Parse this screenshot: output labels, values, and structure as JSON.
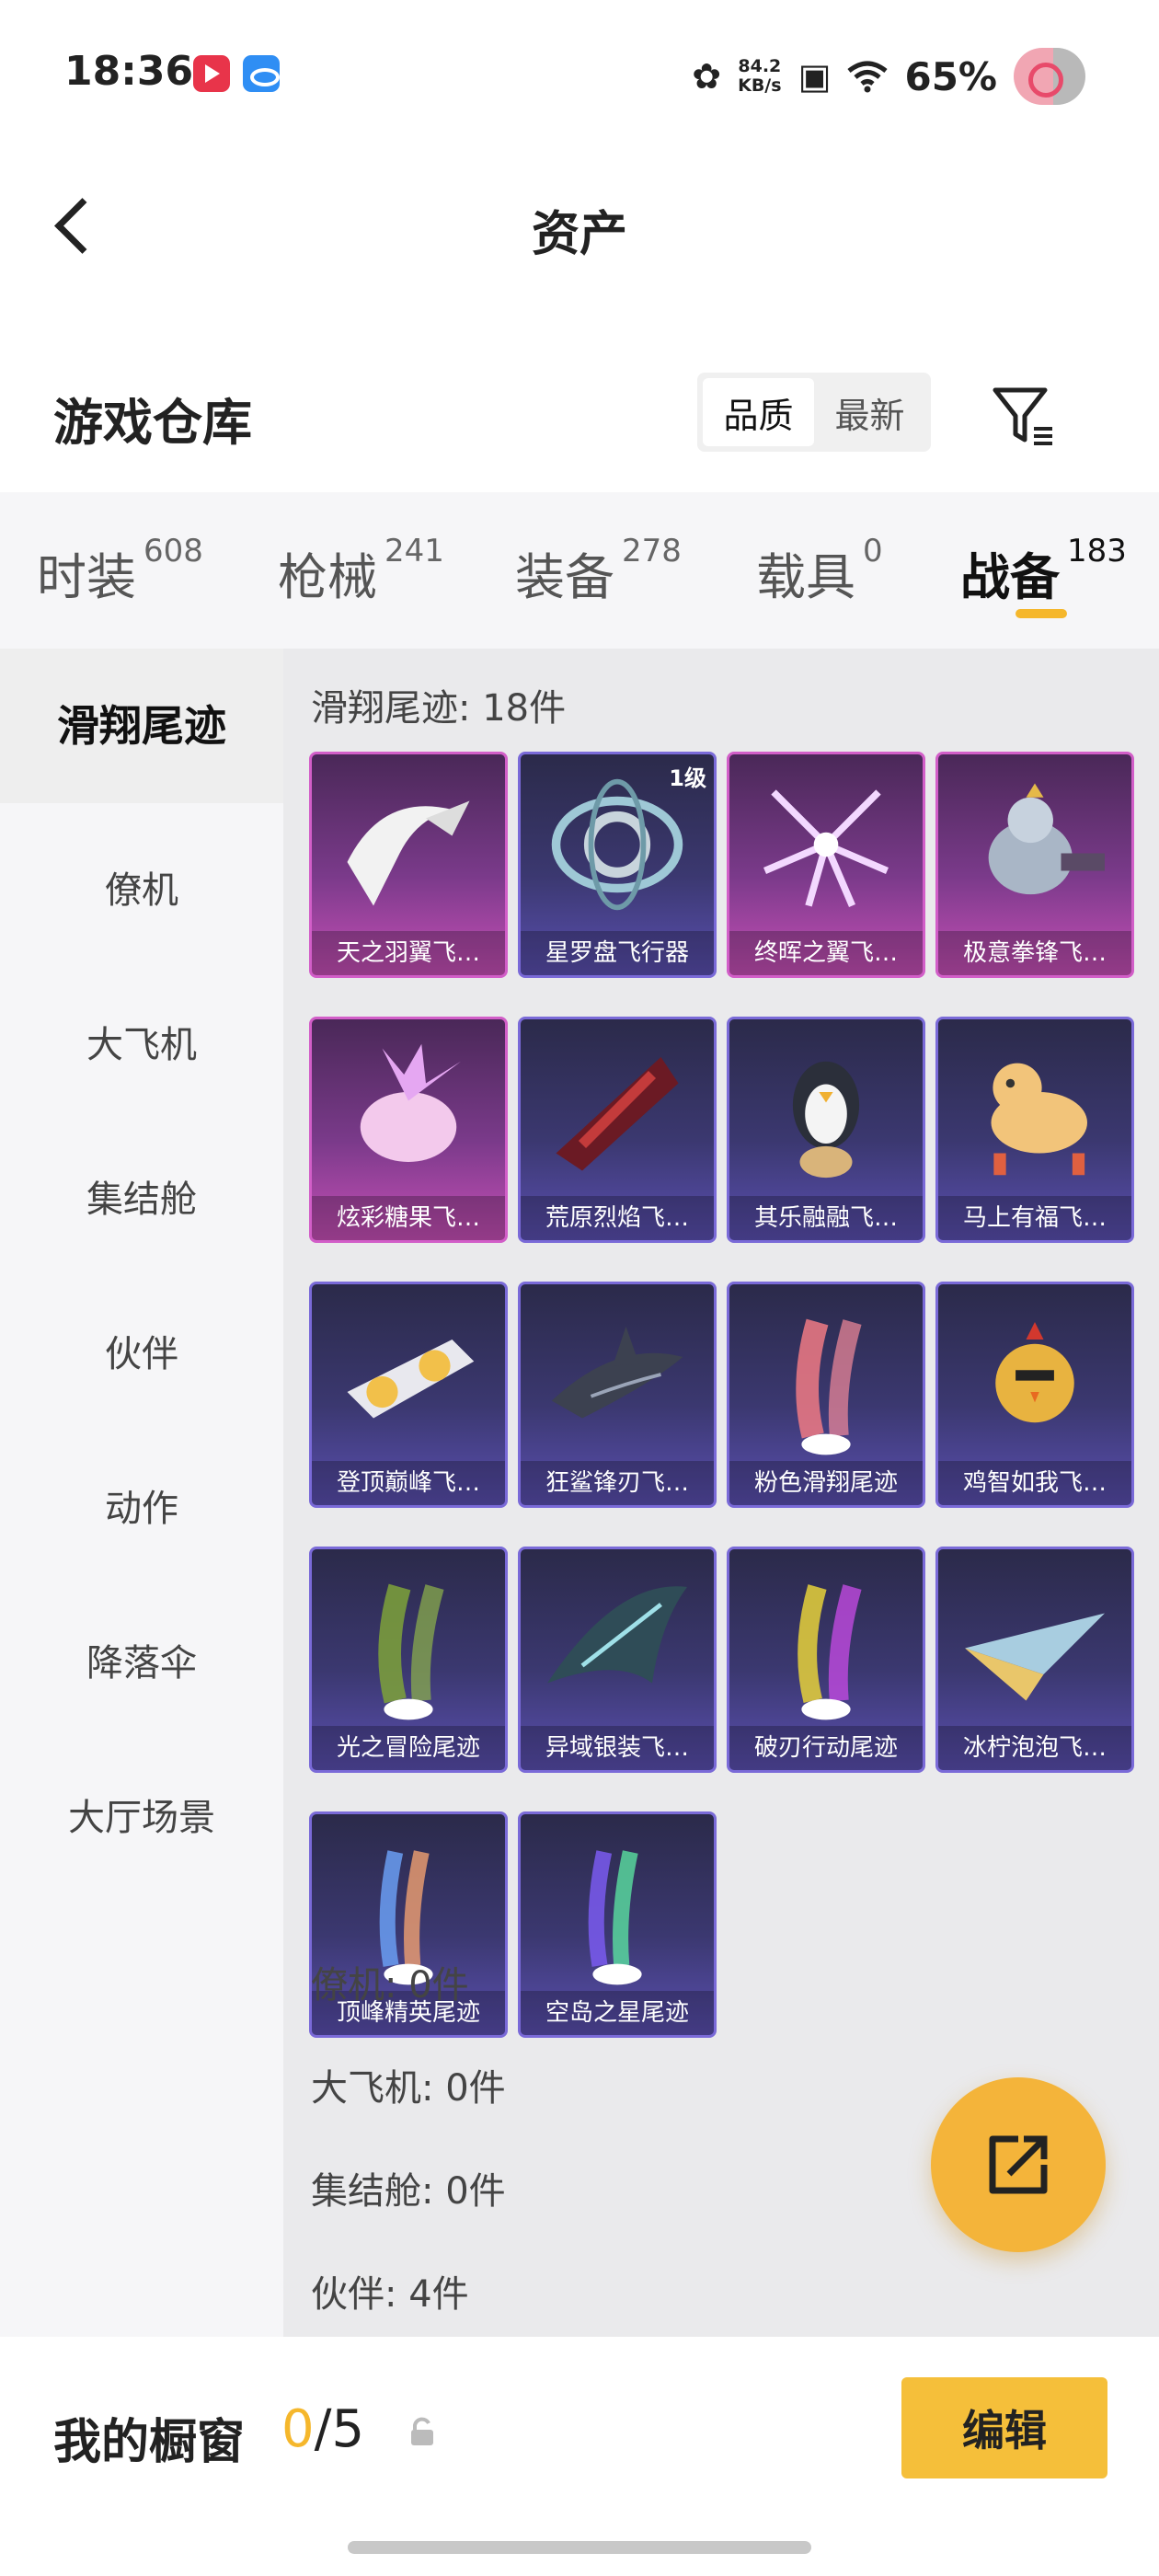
{
  "status_bar": {
    "time": "18:36",
    "net_speed_value": "84.2",
    "net_speed_unit": "KB/s",
    "battery": "65%"
  },
  "nav": {
    "title": "资产"
  },
  "warehouse": {
    "title": "游戏仓库",
    "sort_options": [
      "品质",
      "最新"
    ],
    "sort_selected": "品质"
  },
  "categories": [
    {
      "label": "时装",
      "count": "608"
    },
    {
      "label": "枪械",
      "count": "241"
    },
    {
      "label": "装备",
      "count": "278"
    },
    {
      "label": "载具",
      "count": "0"
    },
    {
      "label": "战备",
      "count": "183",
      "active": true
    }
  ],
  "sidebar": {
    "items": [
      {
        "label": "滑翔尾迹",
        "active": true
      },
      {
        "label": "僚机"
      },
      {
        "label": "大飞机"
      },
      {
        "label": "集结舱"
      },
      {
        "label": "伙伴"
      },
      {
        "label": "动作"
      },
      {
        "label": "降落伞"
      },
      {
        "label": "大厅场景"
      }
    ]
  },
  "main": {
    "glide_section_title": "滑翔尾迹: 18件",
    "items": [
      {
        "name": "天之羽翼飞…",
        "rarity": "pink",
        "icon": "white-wing"
      },
      {
        "name": "星罗盘飞行器",
        "rarity": "purple",
        "icon": "astrolabe",
        "tag": "1级"
      },
      {
        "name": "终晖之翼飞…",
        "rarity": "pink",
        "icon": "star-wing"
      },
      {
        "name": "极意拳锋飞…",
        "rarity": "pink",
        "icon": "boxer-robot"
      },
      {
        "name": "炫彩糖果飞…",
        "rarity": "pink",
        "icon": "candy"
      },
      {
        "name": "荒原烈焰飞…",
        "rarity": "purple",
        "icon": "flame-glider"
      },
      {
        "name": "其乐融融飞…",
        "rarity": "purple",
        "icon": "penguin"
      },
      {
        "name": "马上有福飞…",
        "rarity": "purple",
        "icon": "horse"
      },
      {
        "name": "登顶巅峰飞…",
        "rarity": "purple",
        "icon": "jet-wing"
      },
      {
        "name": "狂鲨锋刃飞…",
        "rarity": "purple",
        "icon": "shark"
      },
      {
        "name": "粉色滑翔尾迹",
        "rarity": "purple",
        "icon": "trail-pink"
      },
      {
        "name": "鸡智如我飞…",
        "rarity": "purple",
        "icon": "chicken"
      },
      {
        "name": "光之冒险尾迹",
        "rarity": "purple",
        "icon": "trail-green"
      },
      {
        "name": "异域银装飞…",
        "rarity": "purple",
        "icon": "dragon-wing"
      },
      {
        "name": "破刃行动尾迹",
        "rarity": "purple",
        "icon": "trail-rainbow"
      },
      {
        "name": "冰柠泡泡飞…",
        "rarity": "purple",
        "icon": "paper-plane"
      },
      {
        "name": "顶峰精英尾迹",
        "rarity": "purple",
        "icon": "trail-spectrum"
      },
      {
        "name": "空岛之星尾迹",
        "rarity": "purple",
        "icon": "trail-star"
      }
    ],
    "other_sections": [
      "僚机: 0件",
      "大飞机: 0件",
      "集结舱: 0件",
      "伙伴: 4件"
    ]
  },
  "bottom": {
    "showcase_label": "我的橱窗",
    "showcase_current": "0",
    "showcase_total": "/5",
    "edit_label": "编辑"
  },
  "colors": {
    "accent": "#f5b72c",
    "edit_button": "#f5bf3a",
    "card_pink": "#c64fb6",
    "card_purple": "#5a4fb0"
  }
}
